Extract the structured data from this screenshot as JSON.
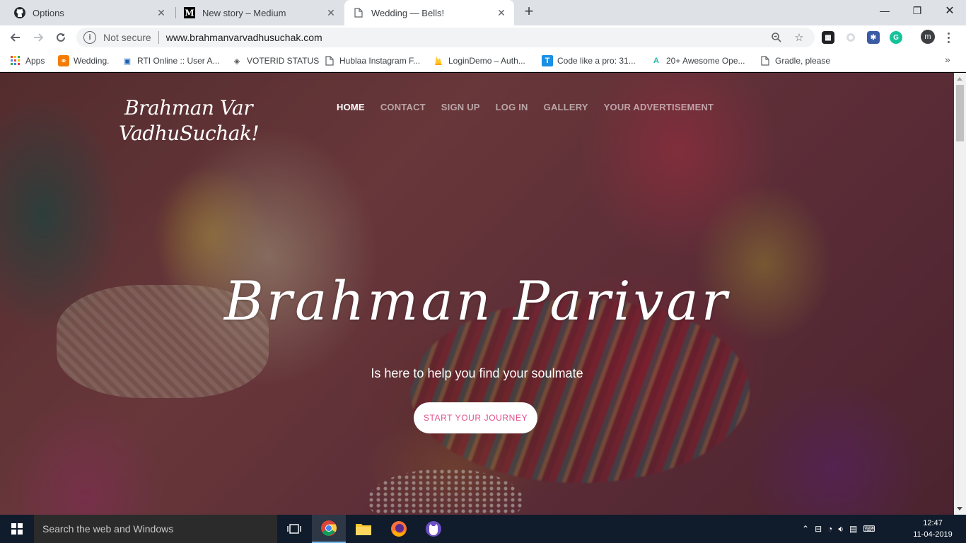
{
  "browser": {
    "tabs": [
      {
        "title": "Options",
        "icon": "github-icon"
      },
      {
        "title": "New story – Medium",
        "icon": "medium-icon"
      },
      {
        "title": "Wedding — Bells!",
        "icon": "page-icon"
      }
    ],
    "url": "www.brahmanvarvadhusuchak.com",
    "security_label": "Not secure",
    "profile_initial": "m"
  },
  "bookmarks": [
    {
      "label": "Apps",
      "icon": "apps-grid-icon"
    },
    {
      "label": "Wedding.",
      "icon": "wedding-bookmark-icon"
    },
    {
      "label": "RTI Online :: User A...",
      "icon": "rti-icon"
    },
    {
      "label": "VOTERID STATUS",
      "icon": "voterid-icon"
    },
    {
      "label": "Hublaa Instagram F...",
      "icon": "page-icon"
    },
    {
      "label": "LoginDemo – Auth...",
      "icon": "firebase-icon"
    },
    {
      "label": "Code like a pro: 31...",
      "icon": "code-icon"
    },
    {
      "label": "20+ Awesome Ope...",
      "icon": "awesome-icon"
    },
    {
      "label": "Gradle, please",
      "icon": "page-icon"
    }
  ],
  "site": {
    "logo_line1": "Brahman Var",
    "logo_line2": "VadhuSuchak!",
    "nav": [
      "HOME",
      "CONTACT",
      "SIGN UP",
      "LOG IN",
      "GALLERY",
      "YOUR ADVERTISEMENT"
    ],
    "active_nav": "HOME",
    "hero_title": "Brahman Parivar",
    "hero_subtitle": "Is here to help you find your soulmate",
    "cta_label": "START YOUR JOURNEY"
  },
  "taskbar": {
    "search_placeholder": "Search the web and Windows",
    "time": "12:47",
    "date": "11-04-2019"
  },
  "colors": {
    "cta_text": "#e0548e",
    "taskbar": "#101c2c",
    "tabstrip": "#dee1e6"
  }
}
